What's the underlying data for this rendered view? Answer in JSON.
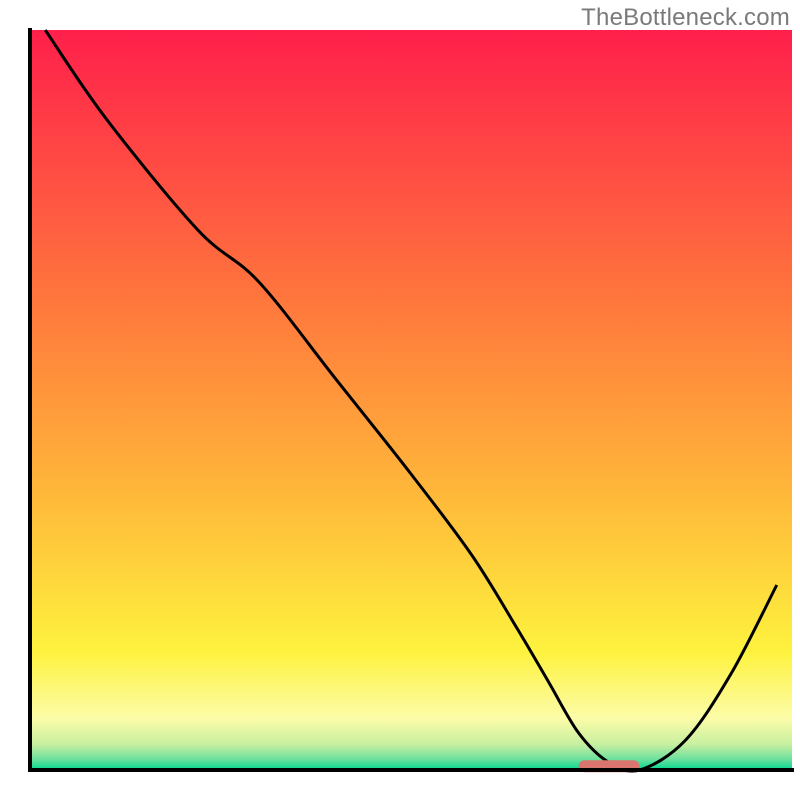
{
  "attribution": "TheBottleneck.com",
  "chart_data": {
    "type": "line",
    "title": "",
    "xlabel": "",
    "ylabel": "",
    "xlim": [
      0,
      100
    ],
    "ylim": [
      0,
      100
    ],
    "gradient_stops": [
      {
        "offset": 0.0,
        "color": "#ff1f4b"
      },
      {
        "offset": 0.38,
        "color": "#ff7a3c"
      },
      {
        "offset": 0.62,
        "color": "#ffb63a"
      },
      {
        "offset": 0.84,
        "color": "#fef23e"
      },
      {
        "offset": 0.93,
        "color": "#fcfca8"
      },
      {
        "offset": 0.965,
        "color": "#c8f0a0"
      },
      {
        "offset": 0.985,
        "color": "#6fe19e"
      },
      {
        "offset": 1.0,
        "color": "#00d890"
      }
    ],
    "series": [
      {
        "name": "bottleneck-curve",
        "x": [
          2,
          10,
          22,
          30,
          40,
          50,
          58,
          64,
          68,
          72,
          76,
          80,
          86,
          92,
          98
        ],
        "y": [
          100,
          88,
          73,
          66,
          53,
          40,
          29,
          19,
          12,
          5,
          1,
          0,
          4,
          13,
          25
        ]
      }
    ],
    "marker": {
      "name": "optimal-range",
      "x_start": 72,
      "x_end": 80,
      "y": 0.5,
      "color": "#d9746f"
    },
    "axes_color": "#000000"
  }
}
